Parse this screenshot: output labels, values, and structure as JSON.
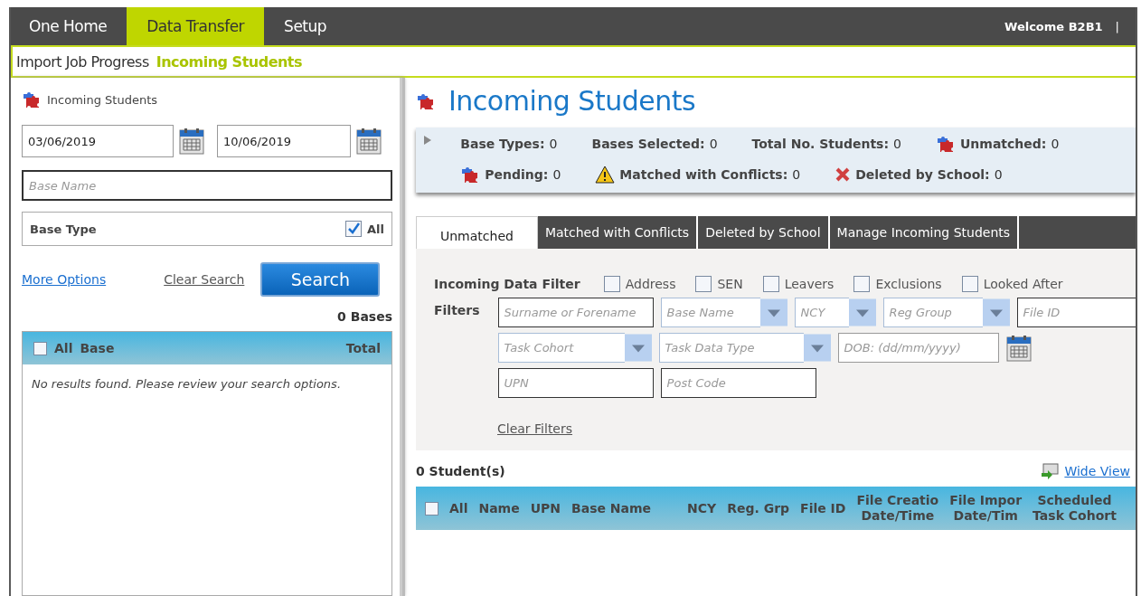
{
  "nav": {
    "tabs": [
      {
        "label": "One Home",
        "selected": false
      },
      {
        "label": "Data Transfer",
        "selected": true
      },
      {
        "label": "Setup",
        "selected": false
      }
    ],
    "welcome": "Welcome  B2B1",
    "separator": "|"
  },
  "breadcrumb": [
    {
      "label": "Import Job Progress",
      "selected": false
    },
    {
      "label": "Incoming Students",
      "selected": true
    }
  ],
  "left": {
    "title": "Incoming Students",
    "date_from": "03/06/2019",
    "date_to": "10/06/2019",
    "base_name_placeholder": "Base Name",
    "base_type": {
      "label": "Base Type",
      "all_label": "All",
      "checked": true
    },
    "more_options": "More Options",
    "clear_search": "Clear Search",
    "search_button": "Search",
    "count": "0 Bases",
    "table": {
      "all_label": "All",
      "all_checked": false,
      "columns": [
        "Base",
        "Total"
      ],
      "empty": "No results found. Please review your search options."
    }
  },
  "main": {
    "title": "Incoming Students",
    "summary": [
      {
        "label": "Base Types:",
        "value": "0",
        "kind": "plain"
      },
      {
        "label": "Bases Selected:",
        "value": "0",
        "kind": "plain"
      },
      {
        "label": "Total No. Students:",
        "value": "0",
        "kind": "plain"
      },
      {
        "label": "Unmatched:",
        "value": "0",
        "kind": "puzzle"
      },
      {
        "label": "Pending:",
        "value": "0",
        "kind": "puzzle"
      },
      {
        "label": "Matched with Conflicts:",
        "value": "0",
        "kind": "warning"
      },
      {
        "label": "Deleted by School:",
        "value": "0",
        "kind": "cross"
      }
    ],
    "tabs": [
      {
        "label": "Unmatched",
        "selected": true
      },
      {
        "label": "Matched with Conflicts",
        "selected": false
      },
      {
        "label": "Deleted by School",
        "selected": false
      },
      {
        "label": "Manage Incoming Students",
        "selected": false
      }
    ],
    "filter_label": "Incoming Data Filter",
    "filter_checks": [
      {
        "label": "Address",
        "checked": false
      },
      {
        "label": "SEN",
        "checked": false
      },
      {
        "label": "Leavers",
        "checked": false
      },
      {
        "label": "Exclusions",
        "checked": false
      },
      {
        "label": "Looked After",
        "checked": false
      }
    ],
    "filters_label": "Filters",
    "filter_rows": [
      [
        {
          "placeholder": "Surname or Forename",
          "kind": "text"
        },
        {
          "placeholder": "Base Name",
          "kind": "select"
        },
        {
          "placeholder": "NCY",
          "kind": "select"
        },
        {
          "placeholder": "Reg Group",
          "kind": "select"
        },
        {
          "placeholder": "File ID",
          "kind": "text"
        }
      ],
      [
        {
          "placeholder": "Task Cohort",
          "kind": "select"
        },
        {
          "placeholder": "Task Data Type",
          "kind": "select"
        },
        {
          "placeholder": "DOB: (dd/mm/yyyy)",
          "kind": "date"
        }
      ],
      [
        {
          "placeholder": "UPN",
          "kind": "text"
        },
        {
          "placeholder": "Post Code",
          "kind": "text"
        }
      ]
    ],
    "clear_filters": "Clear Filters",
    "count": "0 Student(s)",
    "wide_view": "Wide View",
    "table": {
      "all_label": "All",
      "all_checked": false,
      "columns": [
        {
          "lines": [
            "Name"
          ]
        },
        {
          "lines": [
            "UPN"
          ]
        },
        {
          "lines": [
            "Base Name"
          ]
        },
        {
          "lines": [
            "NCY"
          ]
        },
        {
          "lines": [
            "Reg. Grp"
          ]
        },
        {
          "lines": [
            "File ID"
          ]
        },
        {
          "lines": [
            "File Creatio",
            "Date/Time"
          ]
        },
        {
          "lines": [
            "File Impor",
            "Date/Tim"
          ]
        },
        {
          "lines": [
            "Scheduled",
            "Task Cohort"
          ]
        }
      ]
    }
  }
}
